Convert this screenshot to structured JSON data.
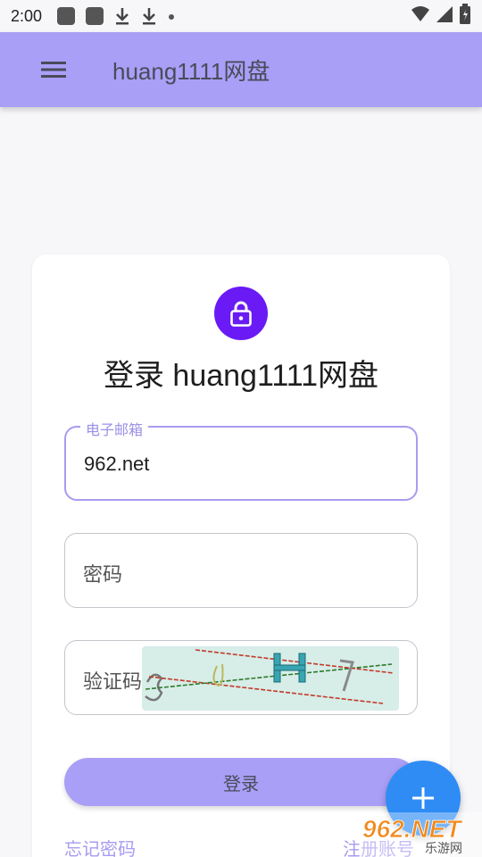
{
  "status_bar": {
    "time": "2:00",
    "icons": [
      "app-icon",
      "app-icon",
      "download-icon",
      "download-icon",
      "dot-icon"
    ],
    "right_icons": [
      "wifi-icon",
      "signal-icon",
      "battery-icon"
    ]
  },
  "app_bar": {
    "title": "huang1111网盘",
    "menu_icon": "menu-icon",
    "color": "#aa9ff7"
  },
  "login_card": {
    "lock_icon": "lock-icon",
    "accent": "#6a1bf5",
    "heading": "登录 huang1111网盘",
    "email": {
      "label": "电子邮箱",
      "value": "962.net"
    },
    "password": {
      "placeholder": "密码"
    },
    "captcha": {
      "placeholder": "验证码"
    },
    "login_button": "登录",
    "forgot_password": "忘记密码",
    "register": "注册账号"
  },
  "fab": {
    "icon": "plus-icon",
    "color": "#2f8cf5"
  },
  "watermark": {
    "text": "962.NET",
    "subtext": "乐游网"
  }
}
